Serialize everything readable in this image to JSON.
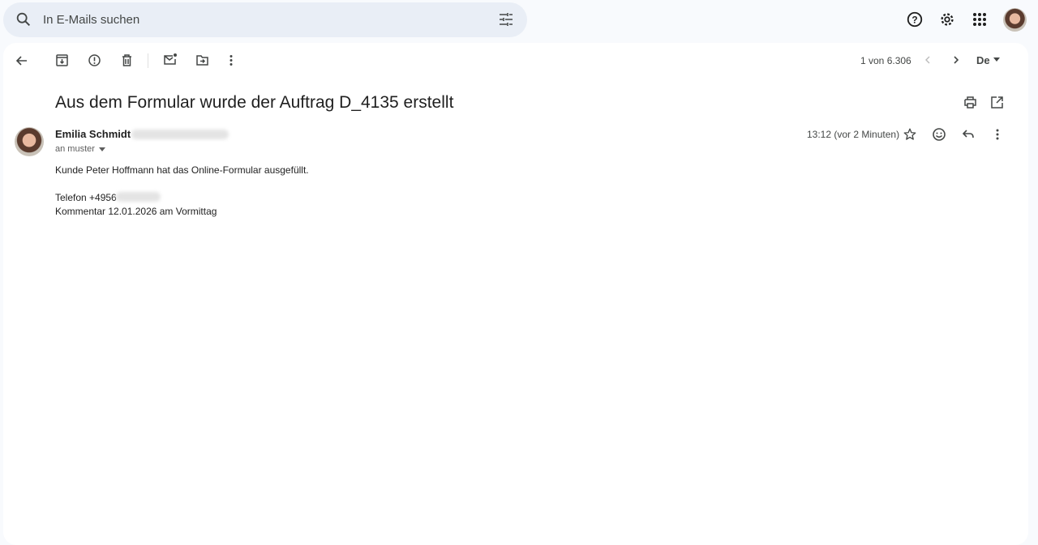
{
  "search": {
    "placeholder": "In E-Mails suchen"
  },
  "toolbar": {
    "count": "1 von 6.306",
    "language": "De"
  },
  "email": {
    "subject": "Aus dem Formular wurde der Auftrag D_4135 erstellt",
    "sender": "Emilia Schmidt",
    "recipient": "an muster",
    "time": "13:12 (vor 2 Minuten)",
    "body_lines": [
      "Kunde Peter Hoffmann hat das Online-Formular ausgefüllt.",
      "",
      "Telefon +4956",
      "Kommentar 12.01.2026 am Vormittag"
    ]
  }
}
